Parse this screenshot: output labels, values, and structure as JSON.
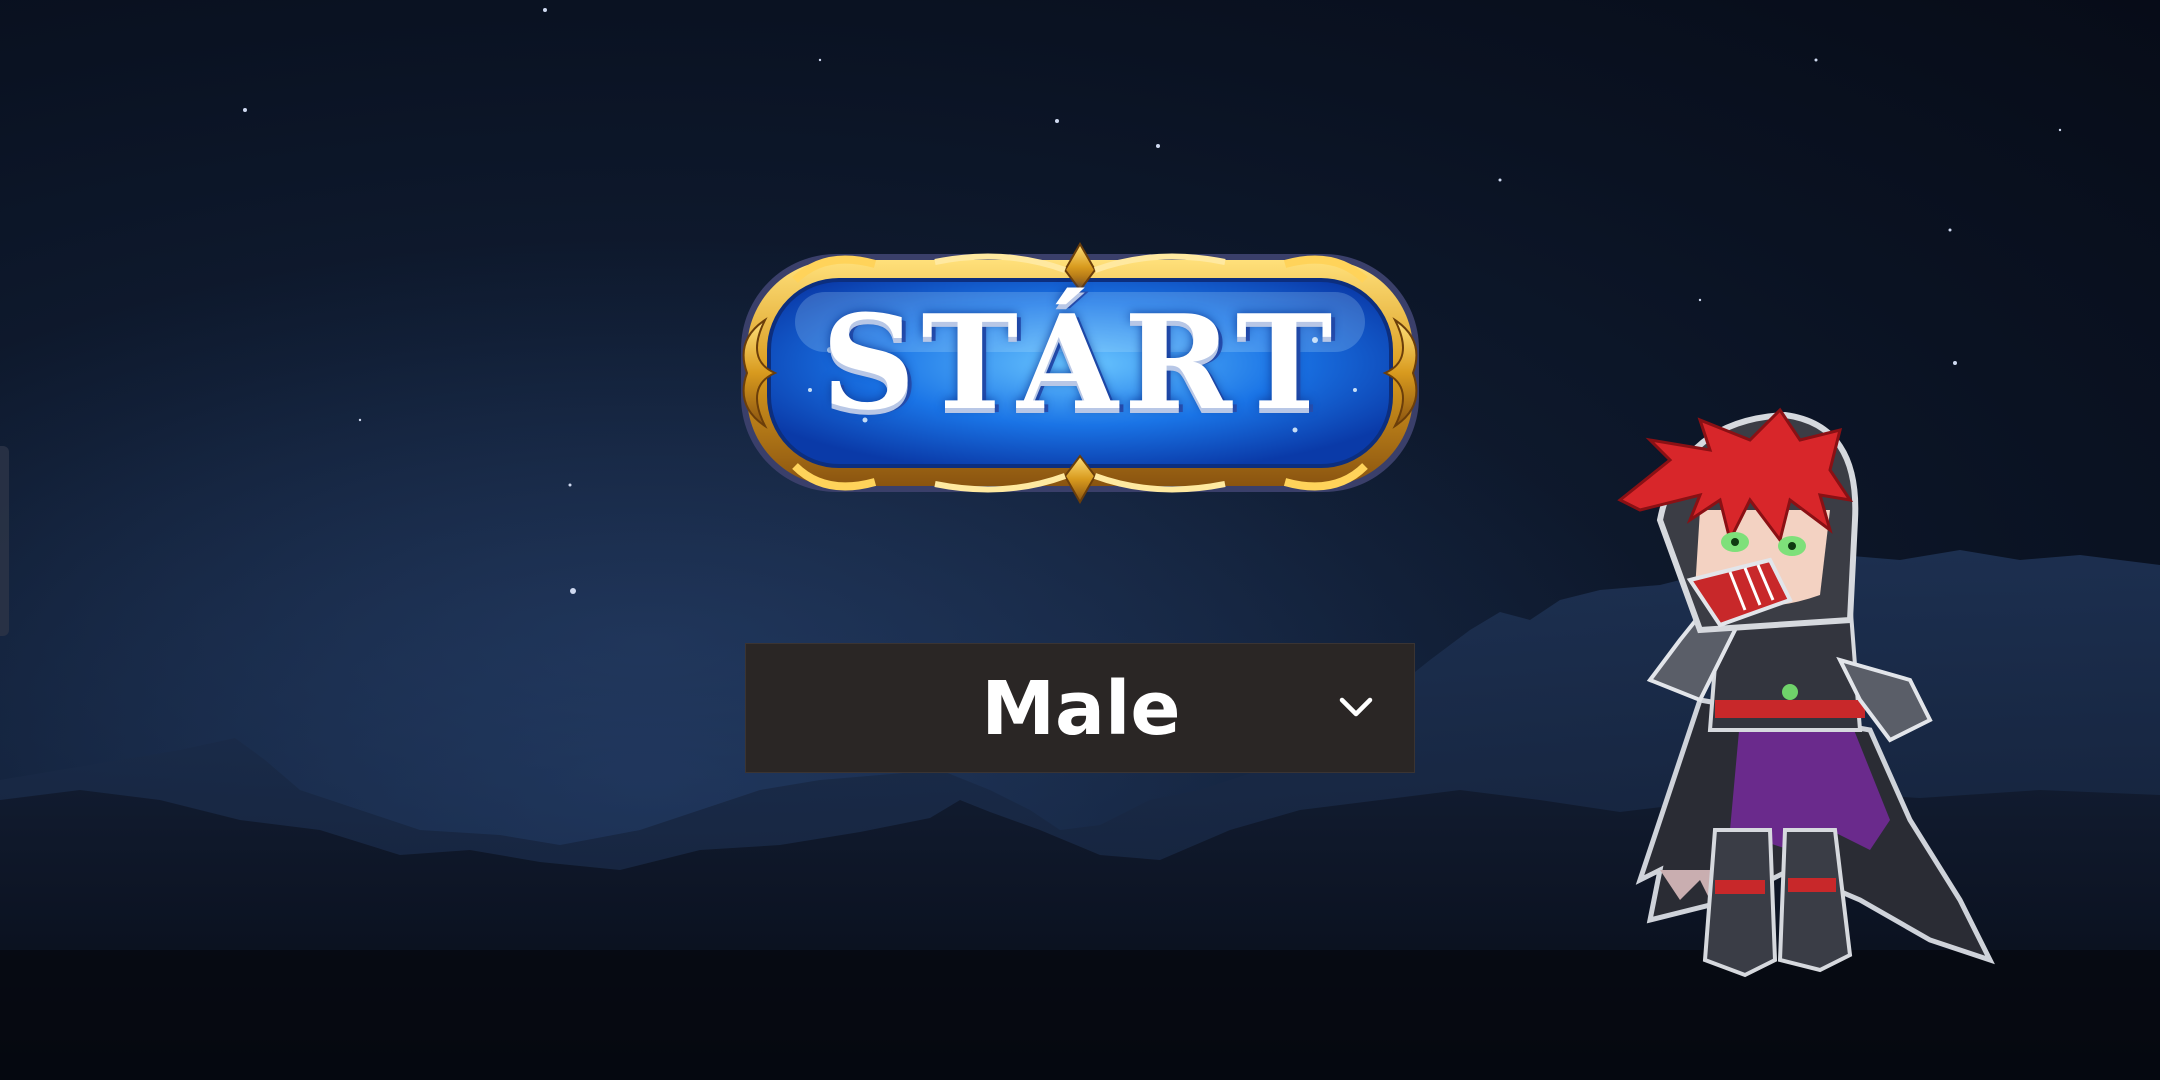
{
  "start_button": {
    "label": "STÁRT",
    "aria_label": "START"
  },
  "gender_select": {
    "selected": "Male",
    "icon": "chevron-down-icon"
  },
  "character": {
    "icon": "character-portrait"
  },
  "colors": {
    "sky_top": "#070c18",
    "sky_mid": "#1a2b48",
    "mountain_far": "#1b2b49",
    "mountain_near": "#0e1628",
    "button_blue": "#1a6fe0",
    "frame_gold": "#d8a22a",
    "dropdown_bg": "#2a2625",
    "character_hair": "#d8262a"
  }
}
